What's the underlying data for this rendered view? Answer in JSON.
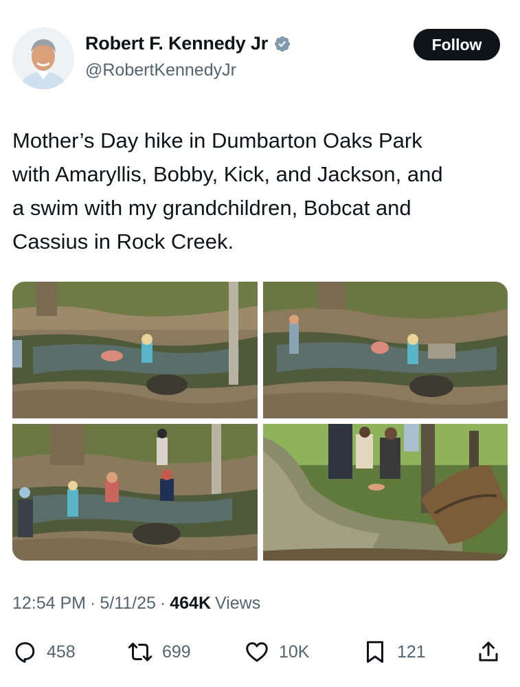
{
  "author": {
    "display_name": "Robert F. Kennedy Jr",
    "handle": "@RobertKennedyJr",
    "verified_icon": "verified-badge-icon",
    "follow_label": "Follow"
  },
  "tweet": {
    "lines": [
      "Mother’s Day hike in Dumbarton Oaks Park",
      "with Amaryllis, Bobby, Kick, and Jackson, and",
      "a swim with my grandchildren, Bobcat and",
      "Cassius in Rock Creek."
    ]
  },
  "media": {
    "count": 4
  },
  "meta": {
    "time": "12:54 PM",
    "sep1": "·",
    "date": "5/11/25",
    "sep2": "·",
    "views_count": "464K",
    "views_label": "Views"
  },
  "actions": {
    "replies": "458",
    "reposts": "699",
    "likes": "10K",
    "bookmarks": "121"
  },
  "colors": {
    "text": "#0f1419",
    "secondary": "#536471",
    "verified": "#829aab",
    "button_bg": "#0f1419"
  }
}
